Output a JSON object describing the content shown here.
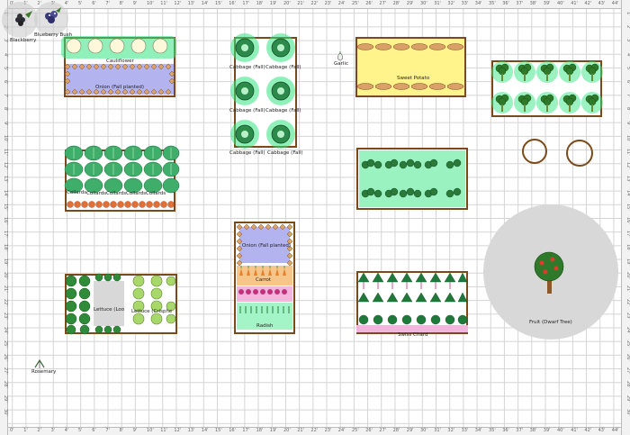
{
  "ruler": {
    "top": [
      "0'",
      "1'",
      "2'",
      "3'",
      "4'",
      "5'",
      "6'",
      "7'",
      "8'",
      "9'",
      "10'",
      "11'",
      "12'",
      "13'",
      "14'",
      "15'",
      "16'",
      "17'",
      "18'",
      "19'",
      "20'",
      "21'",
      "22'",
      "23'",
      "24'",
      "25'",
      "26'",
      "27'",
      "28'",
      "29'",
      "30'",
      "31'",
      "32'",
      "33'",
      "34'",
      "35'",
      "36'",
      "37'",
      "38'",
      "39'",
      "40'",
      "41'",
      "42'",
      "43'",
      "44'"
    ],
    "side": [
      "1'",
      "2'",
      "3'",
      "4'",
      "5'",
      "6'",
      "7'",
      "8'",
      "9'",
      "10'",
      "11'",
      "12'",
      "13'",
      "14'",
      "15'",
      "16'",
      "17'",
      "18'",
      "19'",
      "20'",
      "21'",
      "22'",
      "23'",
      "24'",
      "25'",
      "26'",
      "27'",
      "28'",
      "29'",
      "30'"
    ]
  },
  "labels": {
    "blueberry_bush": "Blueberry Bush",
    "blackberry": "Blackberry",
    "cauliflower": "Cauliflower",
    "onion_fall": "Onion (Fall planted)",
    "cabbage_fall": "Cabbage (Fall)",
    "garlic": "Garlic",
    "sweet_potato": "Sweet Potato",
    "collards": "Collards",
    "onion_fall_2": "Onion (Fall planted)",
    "carrot": "Carrot",
    "radish": "Radish",
    "lettuce_loose": "Lettuce (Loo",
    "lettuce_crisphead": "Lettuce (Crisphe",
    "swiss_chard": "Swiss Chard",
    "fruit_tree": "Fruit (Dwarf Tree)",
    "rosemary": "Rosemary"
  },
  "colors": {
    "bed_border": "#7a4a1a",
    "highlight_green": "#33e680",
    "onion_fill": "#b3b3f0",
    "sweet_potato_fill": "#fff38c",
    "carrot_fill": "#f5c58a",
    "radish_fill": "#f2b6dc",
    "tree_shade": "#d8d8d8"
  }
}
